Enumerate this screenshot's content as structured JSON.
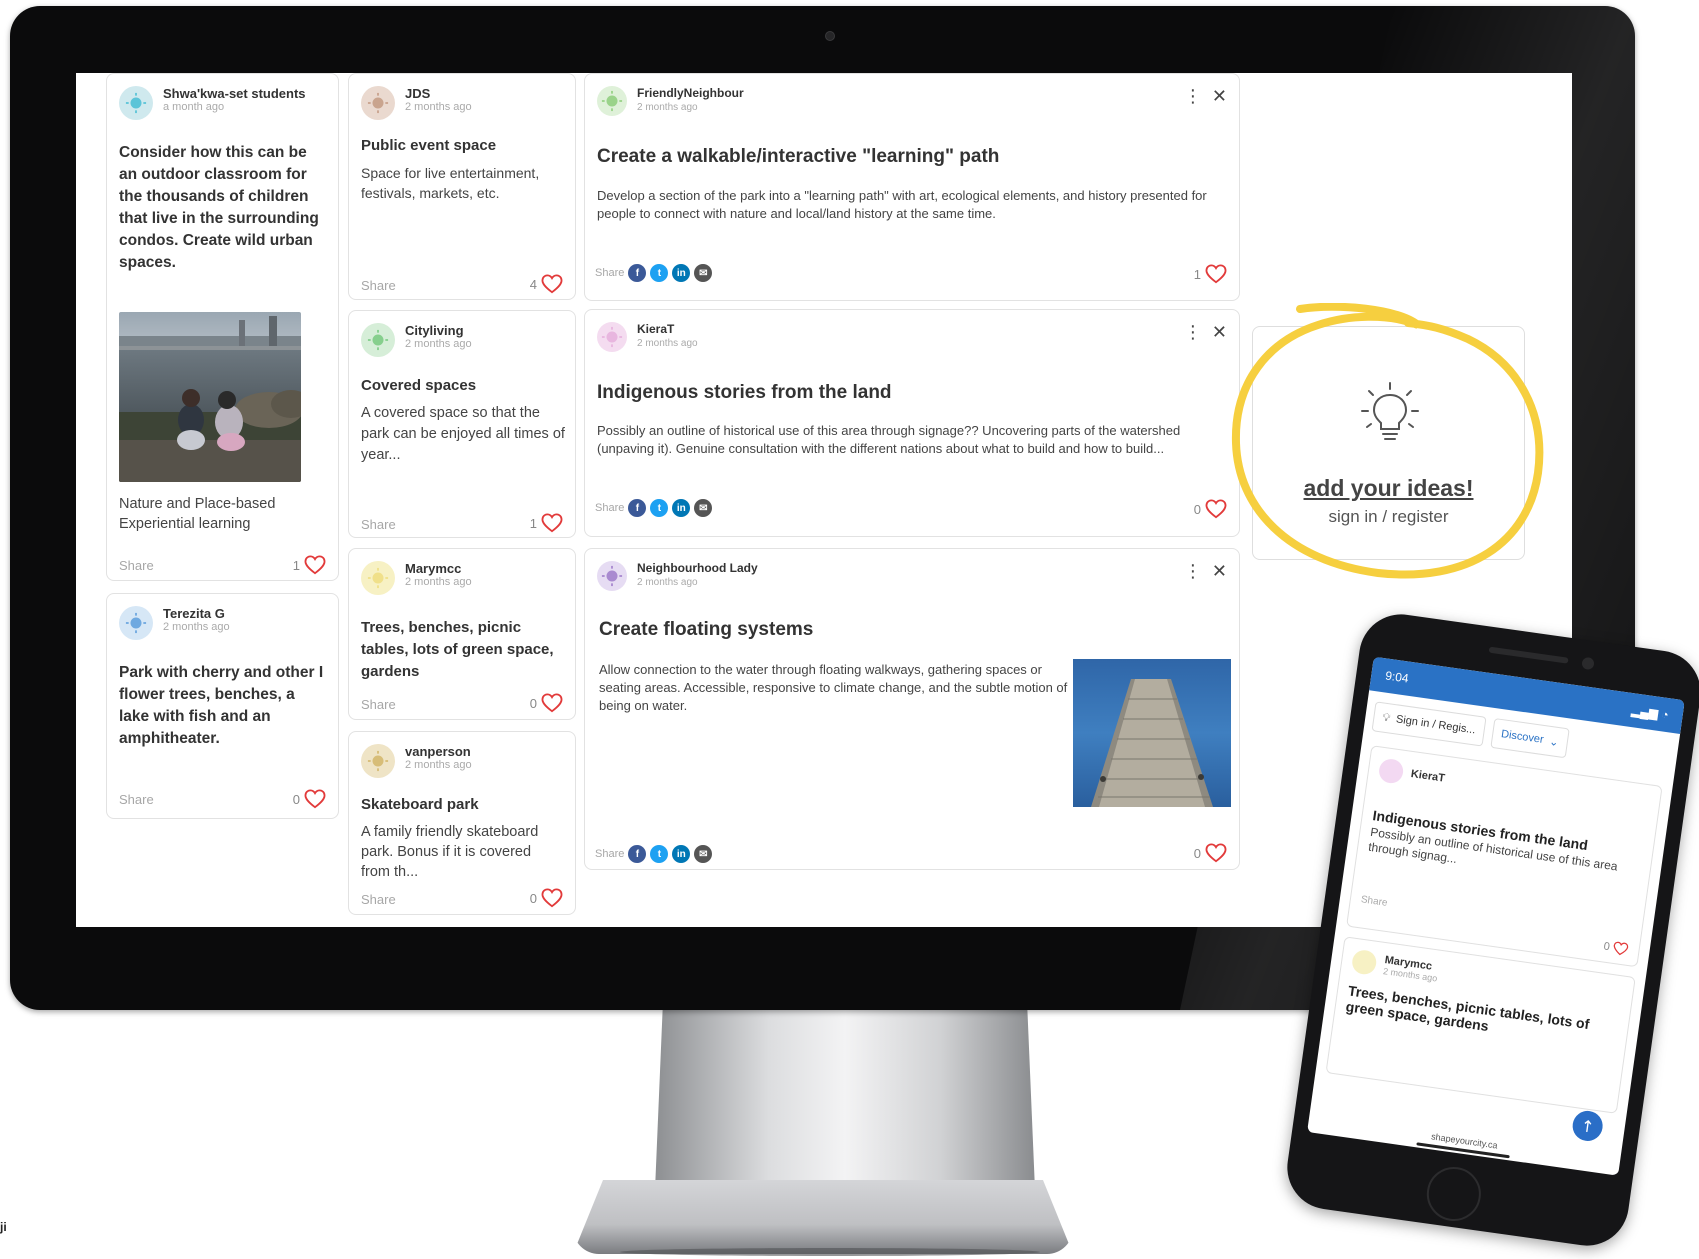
{
  "colors": {
    "heart": "#e23a3a",
    "highlight_circle": "#f6cf3f",
    "facebook": "#3b5998",
    "twitter": "#1da1f2",
    "linkedin": "#0077b5",
    "email": "#555555",
    "phone_bar": "#2a72c5"
  },
  "cards": {
    "shwakwaset": {
      "author": "Shwa'kwa-set students",
      "time": "a month ago",
      "title": "Consider how this can be an outdoor classroom for the thousands of children that live in the surrounding condos. Create wild urban spaces.",
      "caption": "Nature and Place-based Experiential learning",
      "share": "Share",
      "likes": "1"
    },
    "terezita": {
      "author": "Terezita G",
      "time": "2 months ago",
      "title": "Park with cherry and other I flower trees, benches, a lake with fish and an amphitheater.",
      "share": "Share",
      "likes": "0"
    },
    "jds": {
      "author": "JDS",
      "time": "2 months ago",
      "title": "Public event space",
      "body": "Space for live entertainment, festivals, markets, etc.",
      "share": "Share",
      "likes": "4"
    },
    "cityliving": {
      "author": "Cityliving",
      "time": "2 months ago",
      "title": "Covered spaces",
      "body": "A covered space so that the park can be enjoyed all times of year...",
      "share": "Share",
      "likes": "1"
    },
    "marymcc": {
      "author": "Marymcc",
      "time": "2 months ago",
      "title": "Trees, benches, picnic tables, lots of green space, gardens",
      "share": "Share",
      "likes": "0"
    },
    "vanperson": {
      "author": "vanperson",
      "time": "2 months ago",
      "title": "Skateboard park",
      "body": "A family friendly skateboard park. Bonus if it is covered from th...",
      "share": "Share",
      "likes": "0"
    },
    "friendly": {
      "author": "FriendlyNeighbour",
      "time": "2 months ago",
      "title": "Create a walkable/interactive \"learning\" path",
      "body": "Develop a section of the park into a \"learning path\" with art, ecological elements, and history presented for people to connect with nature and local/land history at the same time.",
      "share": "Share",
      "likes": "1"
    },
    "kierat": {
      "author": "KieraT",
      "time": "2 months ago",
      "title": "Indigenous stories from the land",
      "body": "Possibly an outline of historical use of this area through signage?? Uncovering parts of the watershed (unpaving it). Genuine consultation with the different nations about what to build and how to build...",
      "share": "Share",
      "likes": "0"
    },
    "lady": {
      "author": "Neighbourhood Lady",
      "time": "2 months ago",
      "title": "Create floating systems",
      "body": "Allow connection to the water through floating walkways, gathering spaces or seating areas. Accessible, responsive to climate change, and the subtle motion of being on water.",
      "share": "Share",
      "likes": "0"
    }
  },
  "ideas": {
    "title": "add your ideas!",
    "subtitle": "sign in / register"
  },
  "phone": {
    "time": "9:04",
    "signin": "Sign in / Regis...",
    "discover": "Discover",
    "card1": {
      "author": "KieraT",
      "title": "Indigenous stories from the land",
      "body": "Possibly an outline of historical use of this area through signag...",
      "share": "Share",
      "likes": "0"
    },
    "card2": {
      "author": "Marymcc",
      "time": "2 months ago",
      "title": "Trees, benches, picnic tables, lots of green space, gardens"
    },
    "url": "shapeyourcity.ca"
  },
  "corner_mark": "ji"
}
